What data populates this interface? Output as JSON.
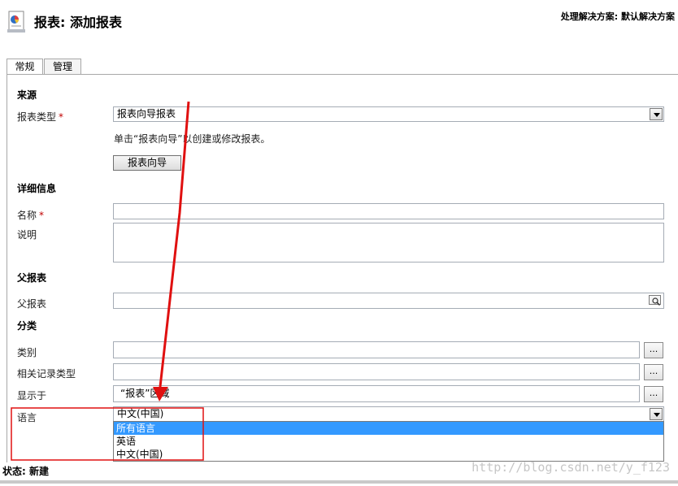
{
  "header": {
    "title": "报表: 添加报表",
    "solution_label": "处理解决方案: 默认解决方案"
  },
  "tabs": [
    {
      "label": "常规"
    },
    {
      "label": "管理"
    }
  ],
  "sections": {
    "source": "来源",
    "details": "详细信息",
    "parent": "父报表",
    "category": "分类"
  },
  "form": {
    "report_type": {
      "label": "报表类型",
      "required_mark": "*",
      "value": "报表向导报表"
    },
    "wizard_hint": "单击“报表向导”以创建或修改报表。",
    "wizard_button": "报表向导",
    "name": {
      "label": "名称",
      "required_mark": "*",
      "value": ""
    },
    "description": {
      "label": "说明",
      "value": ""
    },
    "parent_report": {
      "label": "父报表",
      "value": ""
    },
    "categories": {
      "label": "类别",
      "value": "",
      "button": "..."
    },
    "related_record_types": {
      "label": "相关记录类型",
      "value": "",
      "button": "..."
    },
    "display_in": {
      "label": "显示于",
      "value": "“报表”区域",
      "button": "..."
    },
    "language": {
      "label": "语言",
      "value": "中文(中国)",
      "options": [
        "所有语言",
        "英语",
        "中文(中国)"
      ],
      "highlighted_option": "所有语言"
    }
  },
  "footer": {
    "status": "状态: 新建"
  },
  "watermark": "http://blog.csdn.net/y_f123",
  "colors": {
    "highlight": "#3399ff",
    "required": "#c00000",
    "annotation": "#e01010"
  },
  "icons": [
    "report-icon",
    "lookup-icon",
    "chevron-down-icon"
  ]
}
